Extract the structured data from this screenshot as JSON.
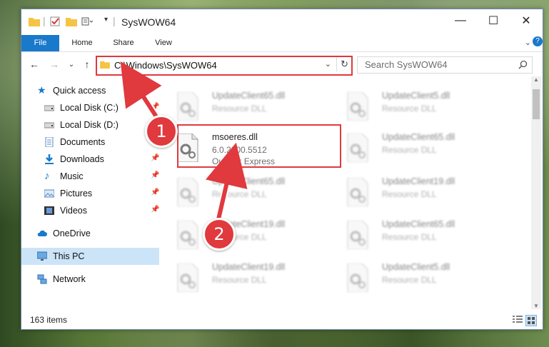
{
  "window": {
    "title": "SysWOW64",
    "minimize_glyph": "—",
    "maximize_glyph": "☐",
    "close_glyph": "✕"
  },
  "ribbon": {
    "tabs": [
      {
        "label": "File"
      },
      {
        "label": "Home"
      },
      {
        "label": "Share"
      },
      {
        "label": "View"
      }
    ]
  },
  "address": {
    "path": "C:\\Windows\\SysWOW64",
    "search_placeholder": "Search SysWOW64"
  },
  "nav_pane": {
    "items": [
      {
        "label": "Quick access",
        "icon": "star-icon",
        "pinned": false
      },
      {
        "label": "Local Disk (C:)",
        "icon": "drive-icon",
        "pinned": true
      },
      {
        "label": "Local Disk (D:)",
        "icon": "drive-icon",
        "pinned": true
      },
      {
        "label": "Documents",
        "icon": "documents-icon",
        "pinned": true
      },
      {
        "label": "Downloads",
        "icon": "download-icon",
        "pinned": true
      },
      {
        "label": "Music",
        "icon": "music-icon",
        "pinned": true
      },
      {
        "label": "Pictures",
        "icon": "pictures-icon",
        "pinned": true
      },
      {
        "label": "Videos",
        "icon": "videos-icon",
        "pinned": true
      },
      {
        "label": "OneDrive",
        "icon": "cloud-icon",
        "pinned": false
      },
      {
        "label": "This PC",
        "icon": "computer-icon",
        "pinned": false,
        "selected": true
      },
      {
        "label": "Network",
        "icon": "network-icon",
        "pinned": false
      }
    ]
  },
  "files": [
    {
      "name": "UpdateClient65.dll",
      "type": "Resource DLL",
      "blurred": true
    },
    {
      "name": "UpdateClient5.dll",
      "type": "Resource DLL",
      "blurred": true
    },
    {
      "name": "msoeres.dll",
      "version": "6.0.2900.5512",
      "description": "Outlook Express",
      "blurred": false
    },
    {
      "name": "UpdateClient65.dll",
      "type": "Resource DLL",
      "blurred": true
    },
    {
      "name": "UpdateClient65.dll",
      "type": "Resource DLL",
      "blurred": true
    },
    {
      "name": "UpdateClient19.dll",
      "type": "Resource DLL",
      "blurred": true
    },
    {
      "name": "UpdateClient19.dll",
      "type": "Resource DLL",
      "blurred": true
    },
    {
      "name": "UpdateClient65.dll",
      "type": "Resource DLL",
      "blurred": true
    },
    {
      "name": "UpdateClient19.dll",
      "type": "Resource DLL",
      "blurred": true
    },
    {
      "name": "UpdateClient5.dll",
      "type": "Resource DLL",
      "blurred": true
    }
  ],
  "status": {
    "item_count": "163 items"
  },
  "annotations": {
    "step1": "1",
    "step2": "2",
    "color": "#e0393e"
  }
}
